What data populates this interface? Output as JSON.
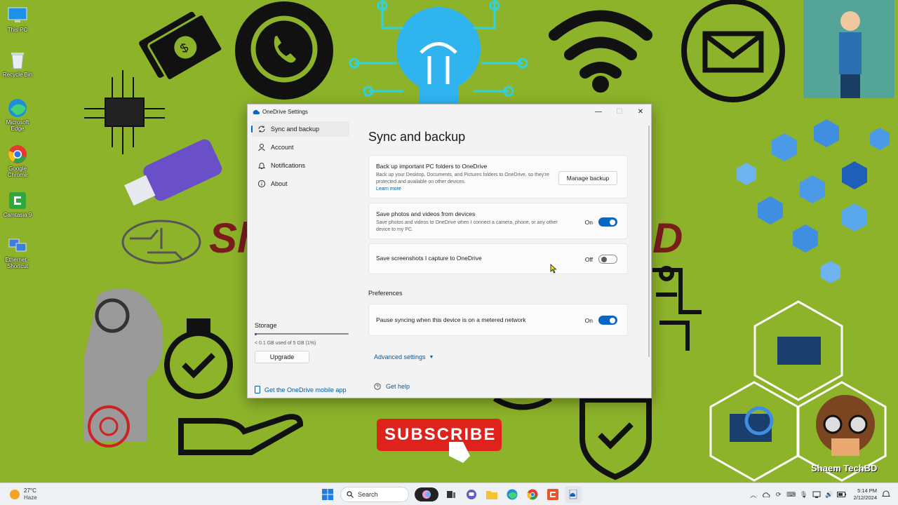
{
  "desktop": {
    "icons": [
      {
        "label": "This PC",
        "icon": "monitor-icon"
      },
      {
        "label": "Recycle Bin",
        "icon": "recycle-bin-icon"
      },
      {
        "label": "Microsoft Edge",
        "icon": "edge-icon"
      },
      {
        "label": "Google Chrome",
        "icon": "chrome-icon"
      },
      {
        "label": "Camtasia 9",
        "icon": "camtasia-icon"
      },
      {
        "label": "Ethernet - Shortcut",
        "icon": "network-icon"
      }
    ],
    "wallpaper": {
      "brand": "Shaem TechBD",
      "subscribe": "SUBSCRIBE"
    }
  },
  "window": {
    "title": "OneDrive Settings",
    "controls": {
      "minimize": "—",
      "maximize": "☐",
      "close": "✕"
    }
  },
  "sidebar": {
    "items": [
      {
        "label": "Sync and backup",
        "icon": "sync-icon",
        "active": true
      },
      {
        "label": "Account",
        "icon": "account-icon",
        "active": false
      },
      {
        "label": "Notifications",
        "icon": "bell-icon",
        "active": false
      },
      {
        "label": "About",
        "icon": "info-icon",
        "active": false
      }
    ],
    "storage": {
      "title": "Storage",
      "used_text": "< 0.1 GB used of 5 GB (1%)",
      "used_fraction": 0.01,
      "upgrade_label": "Upgrade"
    },
    "mobile_app_link": "Get the OneDrive mobile app"
  },
  "main": {
    "title": "Sync and backup",
    "backup": {
      "heading": "Back up important PC folders to OneDrive",
      "description": "Back up your Desktop, Documents, and Pictures folders to OneDrive, so they're protected and available on other devices.",
      "learn_more": "Learn more",
      "button": "Manage backup"
    },
    "photos": {
      "heading": "Save photos and videos from devices",
      "description": "Save photos and videos to OneDrive when I connect a camera, phone, or any other device to my PC.",
      "state_label": "On",
      "enabled": true
    },
    "screenshots": {
      "heading": "Save screenshots I capture to OneDrive",
      "state_label": "Off",
      "enabled": false
    },
    "preferences_label": "Preferences",
    "metered": {
      "heading": "Pause syncing when this device is on a metered network",
      "state_label": "On",
      "enabled": true
    },
    "advanced_settings": "Advanced settings",
    "get_help": "Get help"
  },
  "taskbar": {
    "weather": {
      "temp": "27°C",
      "condition": "Haze"
    },
    "search_placeholder": "Search",
    "time": "5:14 PM",
    "date": "2/12/2024"
  },
  "colors": {
    "accent": "#0a66c2",
    "wallpaper": "#8db32a",
    "link": "#005a9e"
  }
}
